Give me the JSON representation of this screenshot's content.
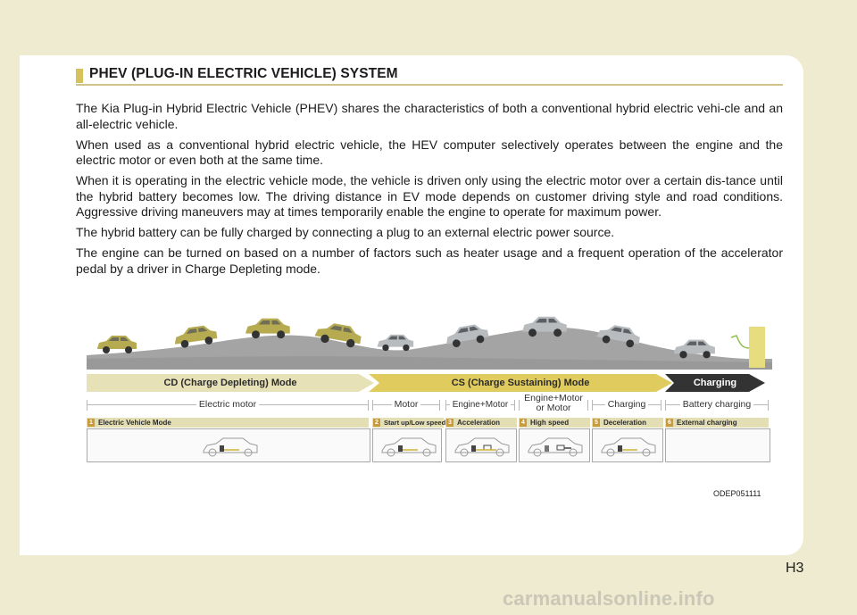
{
  "section": {
    "title": "PHEV (PLUG-IN ELECTRIC VEHICLE) SYSTEM"
  },
  "body": {
    "paragraphs": [
      "The Kia Plug-in Hybrid Electric Vehicle (PHEV) shares the characteristics of both a conventional hybrid electric vehi-cle and an all-electric vehicle.",
      "When used as a conventional hybrid electric vehicle, the HEV computer selectively operates between the engine and the electric motor or even both at the same time.",
      "When it is operating in the electric vehicle mode, the vehicle is driven only using the electric motor over a certain dis-tance until the hybrid battery becomes low. The driving distance in EV mode depends on customer driving style and road conditions. Aggressive driving maneuvers may at times temporarily enable the engine to operate for maximum power.",
      "The hybrid battery can be fully charged by connecting a plug to an external electric power source.",
      "The engine can be turned on based on a number of factors such as  heater usage and a frequent operation of the accelerator pedal by a driver in Charge Depleting mode."
    ]
  },
  "diagram": {
    "modes": {
      "cd": "CD (Charge Depleting) Mode",
      "cs": "CS (Charge Sustaining) Mode",
      "charging": "Charging"
    },
    "power_sources": {
      "electric_motor": "Electric motor",
      "motor": "Motor",
      "engine_motor": "Engine+Motor",
      "engine_or_motor_1": "Engine+Motor",
      "engine_or_motor_2": "or Motor",
      "charging": "Charging",
      "battery_charging": "Battery charging"
    },
    "steps": [
      {
        "num": "1",
        "label": "Electric Vehicle Mode"
      },
      {
        "num": "2",
        "label": "Start up/Low speed"
      },
      {
        "num": "3",
        "label": "Acceleration"
      },
      {
        "num": "4",
        "label": "High speed"
      },
      {
        "num": "5",
        "label": "Deceleration"
      },
      {
        "num": "6",
        "label": "External charging"
      }
    ],
    "figure_code": "ODEP051111",
    "colors": {
      "gold_car": "#b7ab52",
      "silver_car": "#b9bcbf",
      "hill": "#a4a4a4",
      "cs_band": "#dfcb5e",
      "cd_band": "#e7e1b8"
    }
  },
  "page": {
    "number": "H3"
  },
  "watermark": {
    "text": "carmanualsonline.info"
  }
}
